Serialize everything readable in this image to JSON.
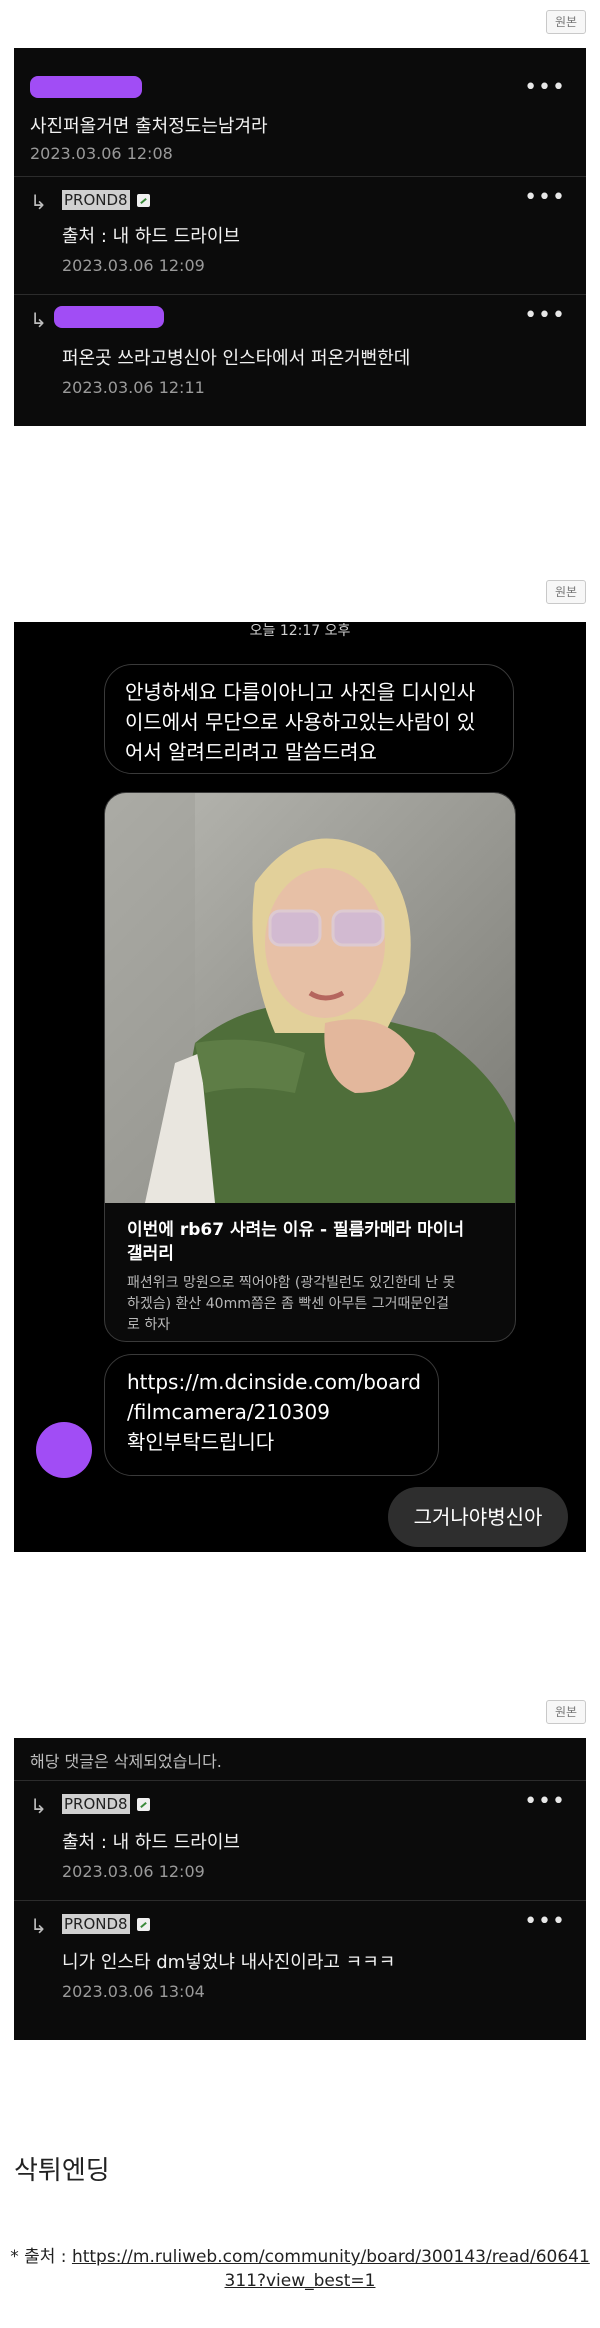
{
  "original_button_label": "원본",
  "comments_1": [
    {
      "text": "사진퍼올거면 출처정도는남겨라",
      "date": "2023.03.06 12:08"
    },
    {
      "nick": "PROND8",
      "text": "출처 : 내 하드 드라이브",
      "date": "2023.03.06 12:09"
    },
    {
      "text": "퍼온곳 쓰라고병신아 인스타에서 퍼온거뻔한데",
      "date": "2023.03.06 12:11"
    }
  ],
  "chat": {
    "time": "오늘 12:17 오후",
    "message_1": "안녕하세요 다름이아니고 사진을 디시인사\n이드에서 무단으로 사용하고있는사람이 있\n어서 알려드리려고 말씀드려요",
    "card_title": "이번에 rb67 사려는 이유 - 필름카메라 마이너\n갤러리",
    "card_desc": "패션위크 망원으로 찍어야함 (광각빌런도 있긴한데 난 못\n하겠슴) 환산 40mm쯤은 좀 빡센 아무튼 그거때문인걸\n로 하자",
    "message_2": "https://m.dcinside.com/board\n/filmcamera/210309\n확인부탁드립니다",
    "reply": "그거나야병신아"
  },
  "comments_2": {
    "deleted_notice": "해당 댓글은 삭제되었습니다.",
    "items": [
      {
        "nick": "PROND8",
        "text": "출처 : 내 하드 드라이브",
        "date": "2023.03.06 12:09"
      },
      {
        "nick": "PROND8",
        "text": "니가 인스타 dm넣었냐 내사진이라고 ㅋㅋㅋ",
        "date": "2023.03.06 13:04"
      }
    ]
  },
  "post_title": "삭튀엔딩",
  "source_label": "* 출처 : ",
  "source_url": "https://m.ruliweb.com/community/board/300143/read/60641311?view_best=1"
}
